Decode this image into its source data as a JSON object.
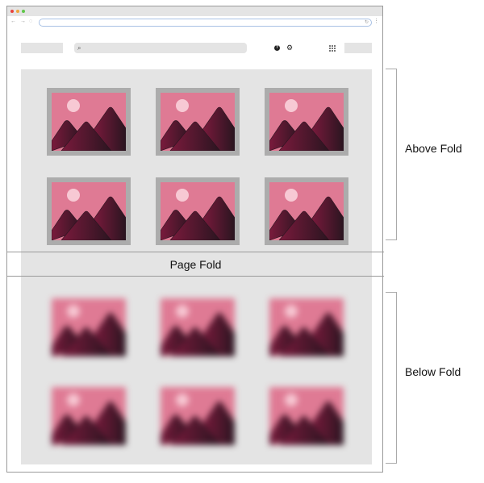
{
  "browser": {
    "window_controls": [
      "close",
      "minimize",
      "maximize"
    ],
    "nav_icons": {
      "back": "←",
      "forward": "→",
      "shield": "◌",
      "reload": "↻",
      "menu": "⋮"
    },
    "url_value": ""
  },
  "header": {
    "search_icon": "⌕",
    "help_icon": "?",
    "gear_icon": "⚙"
  },
  "diagram": {
    "fold_label": "Page Fold",
    "above_label": "Above Fold",
    "below_label": "Below Fold",
    "above_images": 6,
    "below_images": 6,
    "below_images_blurred": true
  },
  "colors": {
    "sky": "#df7a94",
    "sun": "#f7c9d4",
    "mountain_dark": "#2a1520",
    "mountain_mid": "#7a1a3c",
    "frame": "#acacac",
    "panel": "#e4e4e4"
  }
}
